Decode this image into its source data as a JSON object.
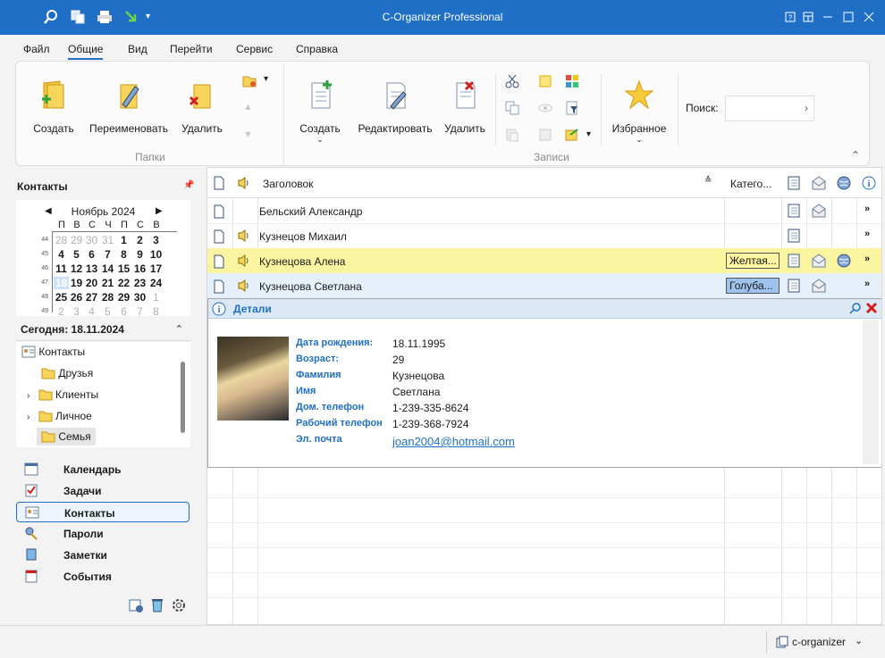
{
  "window": {
    "title": "C-Organizer Professional"
  },
  "menu": [
    "Файл",
    "Общие",
    "Вид",
    "Перейти",
    "Сервис",
    "Справка"
  ],
  "ribbon": {
    "folders": {
      "create": "Создать",
      "rename": "Переименовать",
      "delete": "Удалить",
      "group": "Папки"
    },
    "records": {
      "create": "Создать",
      "edit": "Редактировать",
      "delete": "Удалить",
      "group": "Записи"
    },
    "favorites": "Избранное",
    "search_label": "Поиск:",
    "search_value": ""
  },
  "left": {
    "header": "Контакты",
    "calendar": {
      "month": "Ноябрь 2024",
      "weekdays": [
        "П",
        "В",
        "С",
        "Ч",
        "П",
        "С",
        "В"
      ],
      "weeks": [
        {
          "n": "44",
          "days": [
            [
              "28",
              "o"
            ],
            [
              "29",
              "o"
            ],
            [
              "30",
              "o"
            ],
            [
              "31",
              "o"
            ],
            [
              "1",
              ""
            ],
            [
              "2",
              ""
            ],
            [
              "3",
              ""
            ]
          ]
        },
        {
          "n": "45",
          "days": [
            [
              "4",
              ""
            ],
            [
              "5",
              ""
            ],
            [
              "6",
              ""
            ],
            [
              "7",
              ""
            ],
            [
              "8",
              ""
            ],
            [
              "9",
              ""
            ],
            [
              "10",
              ""
            ]
          ]
        },
        {
          "n": "46",
          "days": [
            [
              "11",
              ""
            ],
            [
              "12",
              ""
            ],
            [
              "13",
              ""
            ],
            [
              "14",
              ""
            ],
            [
              "15",
              ""
            ],
            [
              "16",
              ""
            ],
            [
              "17",
              ""
            ]
          ]
        },
        {
          "n": "47",
          "days": [
            [
              "18",
              "t"
            ],
            [
              "19",
              ""
            ],
            [
              "20",
              ""
            ],
            [
              "21",
              ""
            ],
            [
              "22",
              ""
            ],
            [
              "23",
              ""
            ],
            [
              "24",
              ""
            ]
          ]
        },
        {
          "n": "48",
          "days": [
            [
              "25",
              ""
            ],
            [
              "26",
              ""
            ],
            [
              "27",
              ""
            ],
            [
              "28",
              ""
            ],
            [
              "29",
              ""
            ],
            [
              "30",
              ""
            ],
            [
              "1",
              "o"
            ]
          ]
        },
        {
          "n": "49",
          "days": [
            [
              "2",
              "o"
            ],
            [
              "3",
              "o"
            ],
            [
              "4",
              "o"
            ],
            [
              "5",
              "o"
            ],
            [
              "6",
              "o"
            ],
            [
              "7",
              "o"
            ],
            [
              "8",
              "o"
            ]
          ]
        }
      ]
    },
    "today": "Сегодня: 18.11.2024",
    "tree": [
      "Контакты",
      "Друзья",
      "Клиенты",
      "Личное",
      "Семья"
    ],
    "nav": [
      "Календарь",
      "Задачи",
      "Контакты",
      "Пароли",
      "Заметки",
      "События"
    ]
  },
  "grid": {
    "headers": {
      "title": "Заголовок",
      "category": "Катего..."
    },
    "rows": [
      {
        "name": "Бельский Александр",
        "category": "",
        "sound": false,
        "mail": true,
        "globe": false,
        "style": ""
      },
      {
        "name": "Кузнецов Михаил",
        "category": "",
        "sound": true,
        "mail": false,
        "globe": false,
        "style": ""
      },
      {
        "name": "Кузнецова Алена",
        "category": "Желтая...",
        "sound": true,
        "mail": true,
        "globe": true,
        "style": "yellow"
      },
      {
        "name": "Кузнецова Светлана",
        "category": "Голуба...",
        "sound": true,
        "mail": true,
        "globe": false,
        "style": "blue"
      }
    ],
    "category_colors": {
      "Желтая...": "#fbf5a2",
      "Голуба...": "#9ec3ec"
    }
  },
  "details": {
    "title": "Детали",
    "fields": [
      {
        "label": "Дата рождения:",
        "value": "18.11.1995"
      },
      {
        "label": "Возраст:",
        "value": "29"
      },
      {
        "label": "Фамилия",
        "value": "Кузнецова"
      },
      {
        "label": "Имя",
        "value": "Светлана"
      },
      {
        "label": "Дом. телефон",
        "value": "1-239-335-8624"
      },
      {
        "label": "Рабочий телефон",
        "value": "1-239-368-7924"
      },
      {
        "label": "Эл. почта",
        "value": "joan2004@hotmail.com"
      }
    ]
  },
  "status": {
    "db": "c-organizer"
  }
}
